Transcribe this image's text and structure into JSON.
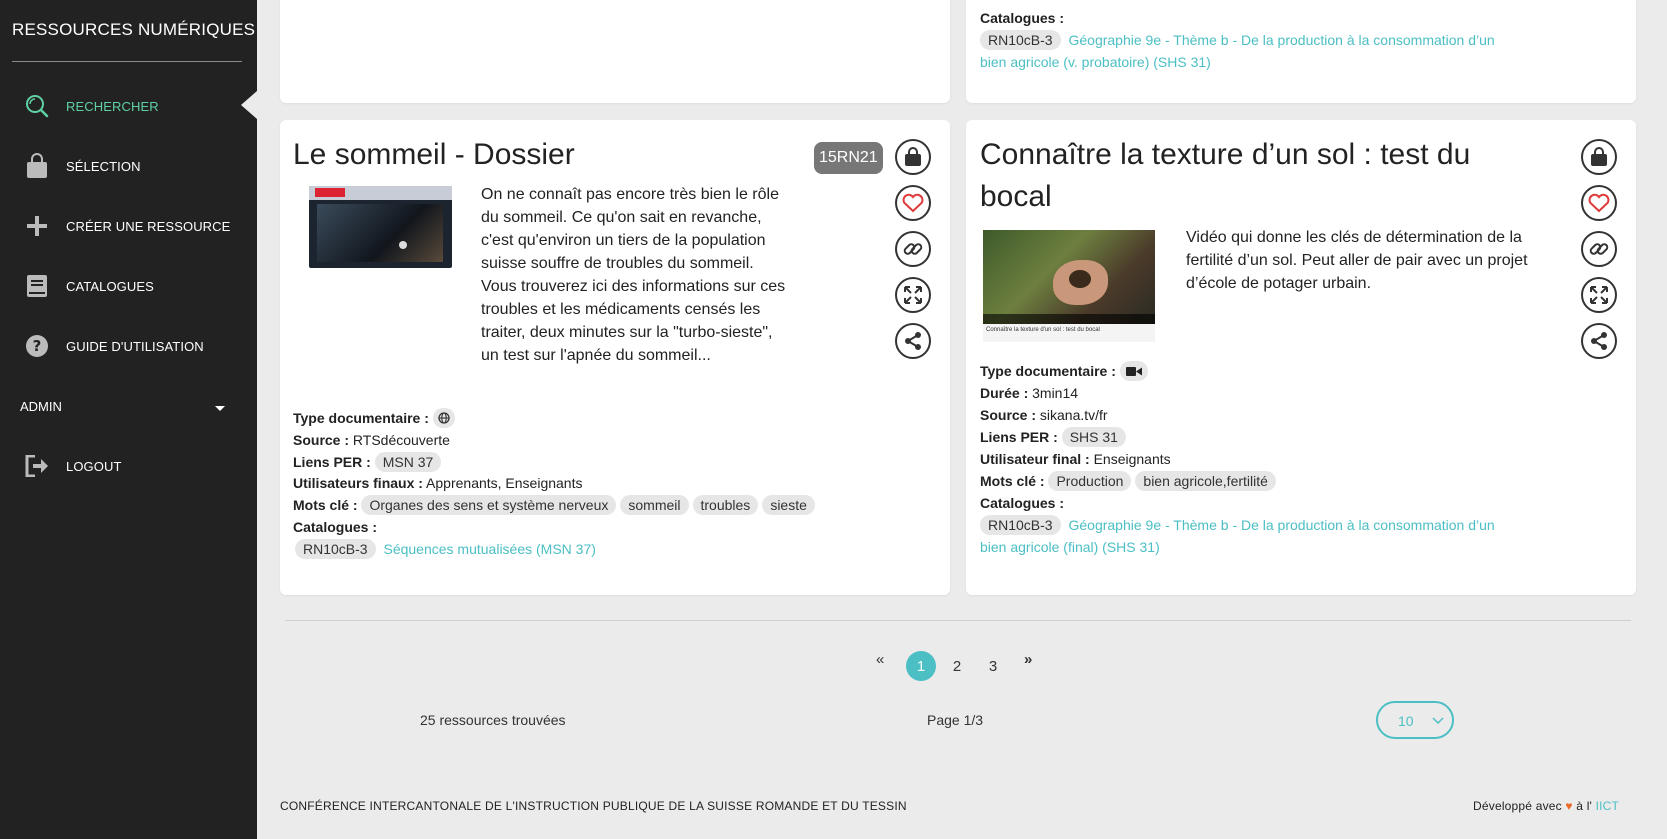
{
  "sidebar": {
    "brand": "RESSOURCES NUMÉRIQUES",
    "items": [
      {
        "label": "RECHERCHER",
        "icon": "search-icon"
      },
      {
        "label": "SÉLECTION",
        "icon": "bag-icon"
      },
      {
        "label": "CRÉER UNE RESSOURCE",
        "icon": "plus-icon"
      },
      {
        "label": "CATALOGUES",
        "icon": "book-icon"
      },
      {
        "label": "GUIDE D'UTILISATION",
        "icon": "help-icon"
      }
    ],
    "admin": "ADMIN",
    "logout": "LOGOUT",
    "active_color": "#5fd0a4"
  },
  "top_right_card": {
    "catalogues_label": "Catalogues :",
    "catalogue_code": "RN10cB-3",
    "catalogue_link_line1": "Géographie 9e - Thème b - De la production à la consommation d’un",
    "catalogue_link_line2": "bien agricole (v. probatoire) (SHS 31)"
  },
  "card_left": {
    "title": "Le sommeil - Dossier",
    "code": "15RN21",
    "description": "On ne connaît pas encore très bien le rôle du sommeil. Ce qu'on sait en revanche, c'est qu'environ un tiers de la population suisse souffre de troubles du sommeil. Vous trouverez ici des informations sur ces troubles et les médicaments censés les traiter, deux minutes sur la \"turbo-sieste\", un test sur l'apnée du sommeil...",
    "type_label": "Type documentaire :",
    "type_icon": "globe-icon",
    "source_label": "Source :",
    "source": "RTSdécouverte",
    "per_label": "Liens PER :",
    "per": "MSN 37",
    "users_label": "Utilisateurs finaux :",
    "users": "Apprenants, Enseignants",
    "keywords_label": "Mots clé :",
    "keywords": [
      "Organes des sens et système nerveux",
      "sommeil",
      "troubles",
      "sieste"
    ],
    "catalogues_label": "Catalogues :",
    "catalogue_code": "RN10cB-3",
    "catalogue_link": "Séquences mutualisées (MSN 37)"
  },
  "card_right": {
    "title_line1": "Connaître la texture d’un sol : test du",
    "title_line2": "bocal",
    "description": "Vidéo qui donne les clés de détermination de la fertilité d’un sol. Peut aller de pair avec un projet d’école de potager urbain.",
    "thumb_caption": "Connaître la texture d'un sol : test du bocal",
    "type_label": "Type documentaire :",
    "type_icon": "video-icon",
    "duration_label": "Durée :",
    "duration": "3min14",
    "source_label": "Source :",
    "source": "sikana.tv/fr",
    "per_label": "Liens PER :",
    "per": "SHS 31",
    "users_label": "Utilisateur final :",
    "users": "Enseignants",
    "keywords_label": "Mots clé :",
    "keywords": [
      "Production",
      "bien agricole,fertilité"
    ],
    "catalogues_label": "Catalogues :",
    "catalogue_code": "RN10cB-3",
    "catalogue_link_line1": "Géographie 9e - Thème b - De la production à la consommation d’un",
    "catalogue_link_line2": "bien agricole (final) (SHS 31)"
  },
  "pagination": {
    "first": "«",
    "pages": [
      "1",
      "2",
      "3"
    ],
    "last": "»",
    "current": "1",
    "results": "25 ressources trouvées",
    "page_info": "Page 1/3",
    "per_page": "10"
  },
  "footer": {
    "left": "CONFÉRENCE INTERCANTONALE DE L'INSTRUCTION PUBLIQUE DE LA SUISSE ROMANDE ET DU TESSIN",
    "right_prefix": "Développé avec",
    "right_mid": "à l'",
    "right_link": "IICT"
  },
  "colors": {
    "accent": "#4bbfc4",
    "sidebar_bg": "#222222",
    "heart": "#e03a3a"
  }
}
